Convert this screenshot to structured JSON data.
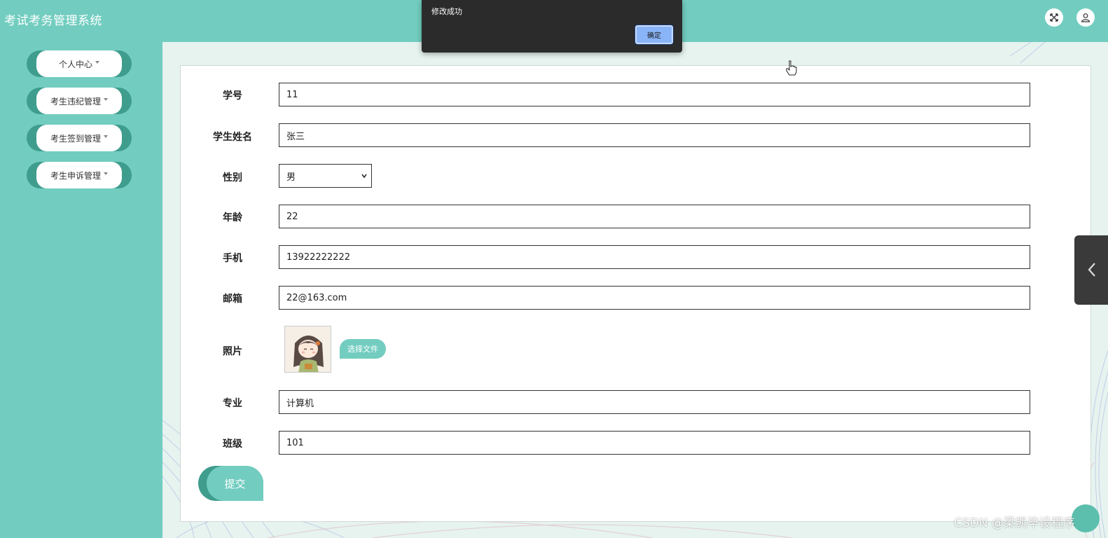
{
  "header": {
    "title": "考试考务管理系统"
  },
  "sidebar": {
    "items": [
      {
        "label": "个人中心"
      },
      {
        "label": "考生违纪管理"
      },
      {
        "label": "考生签到管理"
      },
      {
        "label": "考生申诉管理"
      }
    ]
  },
  "form": {
    "fields": [
      {
        "label": "学号",
        "value": "11"
      },
      {
        "label": "学生姓名",
        "value": "张三"
      },
      {
        "label": "性别",
        "value": "男"
      },
      {
        "label": "年龄",
        "value": "22"
      },
      {
        "label": "手机",
        "value": "13922222222"
      },
      {
        "label": "邮箱",
        "value": "22@163.com"
      },
      {
        "label": "照片",
        "button": "选择文件"
      },
      {
        "label": "专业",
        "value": "计算机"
      },
      {
        "label": "班级",
        "value": "101"
      }
    ],
    "submit_label": "提交"
  },
  "dialog": {
    "message": "修改成功",
    "ok_label": "确定"
  },
  "watermark": "CSDN @梁凯毕设程序",
  "colors": {
    "primary": "#72cdc0",
    "dark": "#3f9d8e",
    "dialog": "#2b2b2b",
    "ok": "#8ab4f8"
  }
}
